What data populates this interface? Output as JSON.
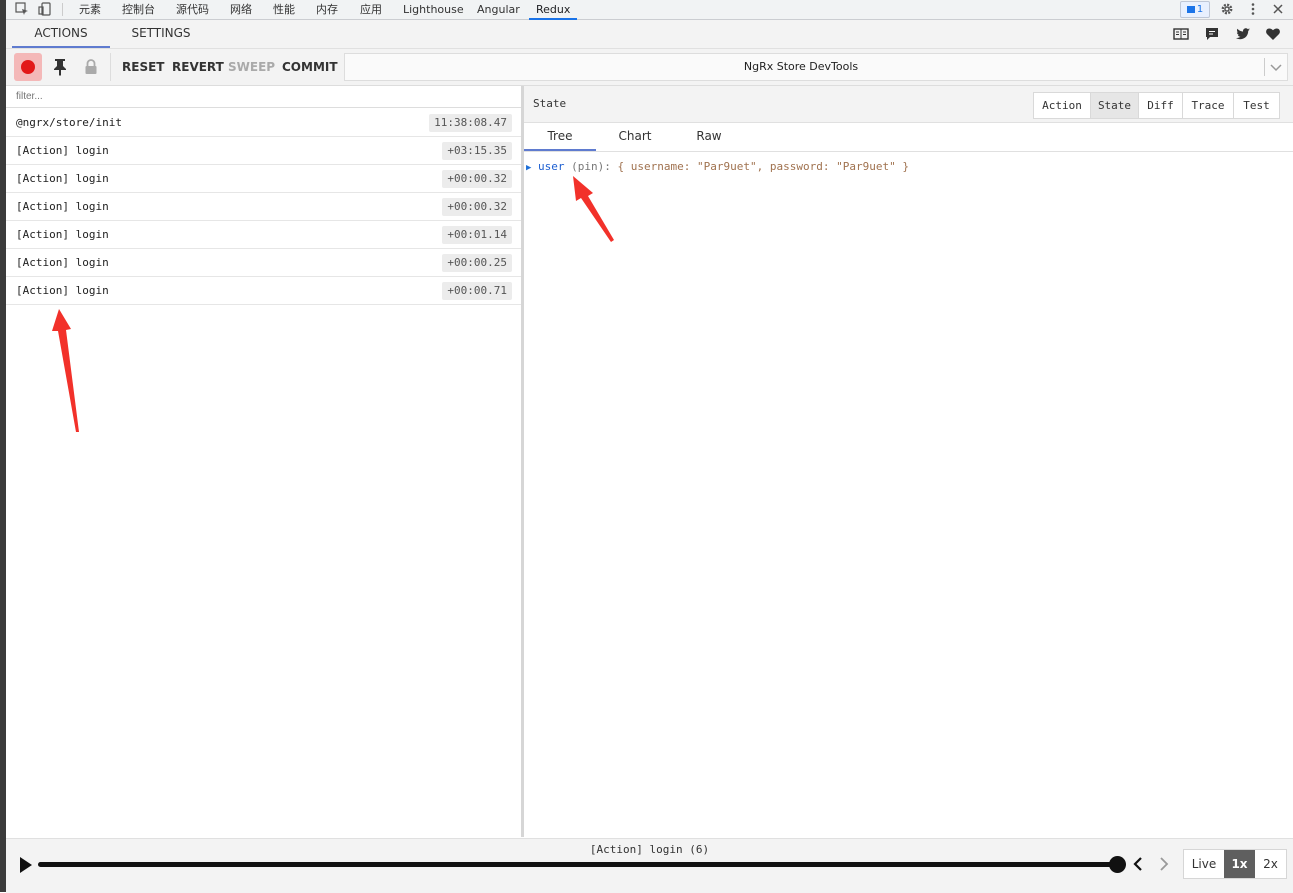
{
  "devtools": {
    "tabs": [
      "元素",
      "控制台",
      "源代码",
      "网络",
      "性能",
      "内存",
      "应用",
      "Lighthouse",
      "Angular",
      "Redux"
    ],
    "active_tab": "Redux",
    "issues_count": "1"
  },
  "app": {
    "tabs": [
      "ACTIONS",
      "SETTINGS"
    ],
    "active_tab": "ACTIONS"
  },
  "toolbar": {
    "reset": "RESET",
    "revert": "REVERT",
    "sweep": "SWEEP",
    "commit": "COMMIT",
    "store": "NgRx Store DevTools"
  },
  "actions": {
    "filter_placeholder": "filter...",
    "items": [
      {
        "name": "@ngrx/store/init",
        "time": "11:38:08.47"
      },
      {
        "name": "[Action] login",
        "time": "+03:15.35"
      },
      {
        "name": "[Action] login",
        "time": "+00:00.32"
      },
      {
        "name": "[Action] login",
        "time": "+00:00.32"
      },
      {
        "name": "[Action] login",
        "time": "+00:01.14"
      },
      {
        "name": "[Action] login",
        "time": "+00:00.25"
      },
      {
        "name": "[Action] login",
        "time": "+00:00.71"
      }
    ]
  },
  "inspector": {
    "title": "State",
    "modes": [
      "Action",
      "State",
      "Diff",
      "Trace",
      "Test"
    ],
    "active_mode": "State",
    "subtabs": [
      "Tree",
      "Chart",
      "Raw"
    ],
    "active_subtab": "Tree",
    "tree": {
      "key": "user",
      "pin": "(pin)",
      "value": "{ username: \"Par9uet\", password: \"Par9uet\" }"
    }
  },
  "slider": {
    "current_action": "[Action] login (6)",
    "speeds": [
      "Live",
      "1x",
      "2x"
    ],
    "active_speed": "1x"
  },
  "colors": {
    "record": "#e21818",
    "accent": "#5f7bcf",
    "annotation_arrow": "#f2312a"
  }
}
